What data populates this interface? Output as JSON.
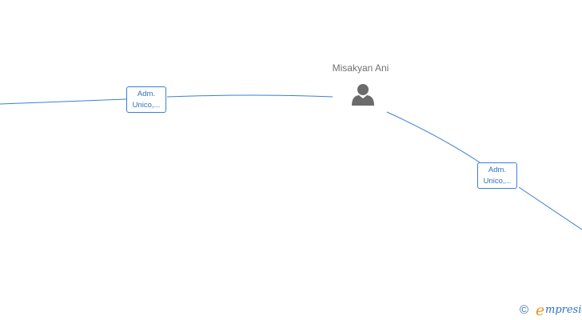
{
  "person": {
    "name": "Misakyan Ani",
    "icon": "person-silhouette-icon"
  },
  "relations": [
    {
      "line1": "Adm.",
      "line2": "Unico,..."
    },
    {
      "line1": "Adm.",
      "line2": "Unico,..."
    }
  ],
  "footer": {
    "copyright_symbol": "©",
    "brand_initial": "e",
    "brand_rest": "mpresia"
  },
  "colors": {
    "edge": "#3a7fd6",
    "person_icon": "#6b6b6b",
    "brand_orange": "#f0901c",
    "brand_blue": "#2f6fc4"
  }
}
